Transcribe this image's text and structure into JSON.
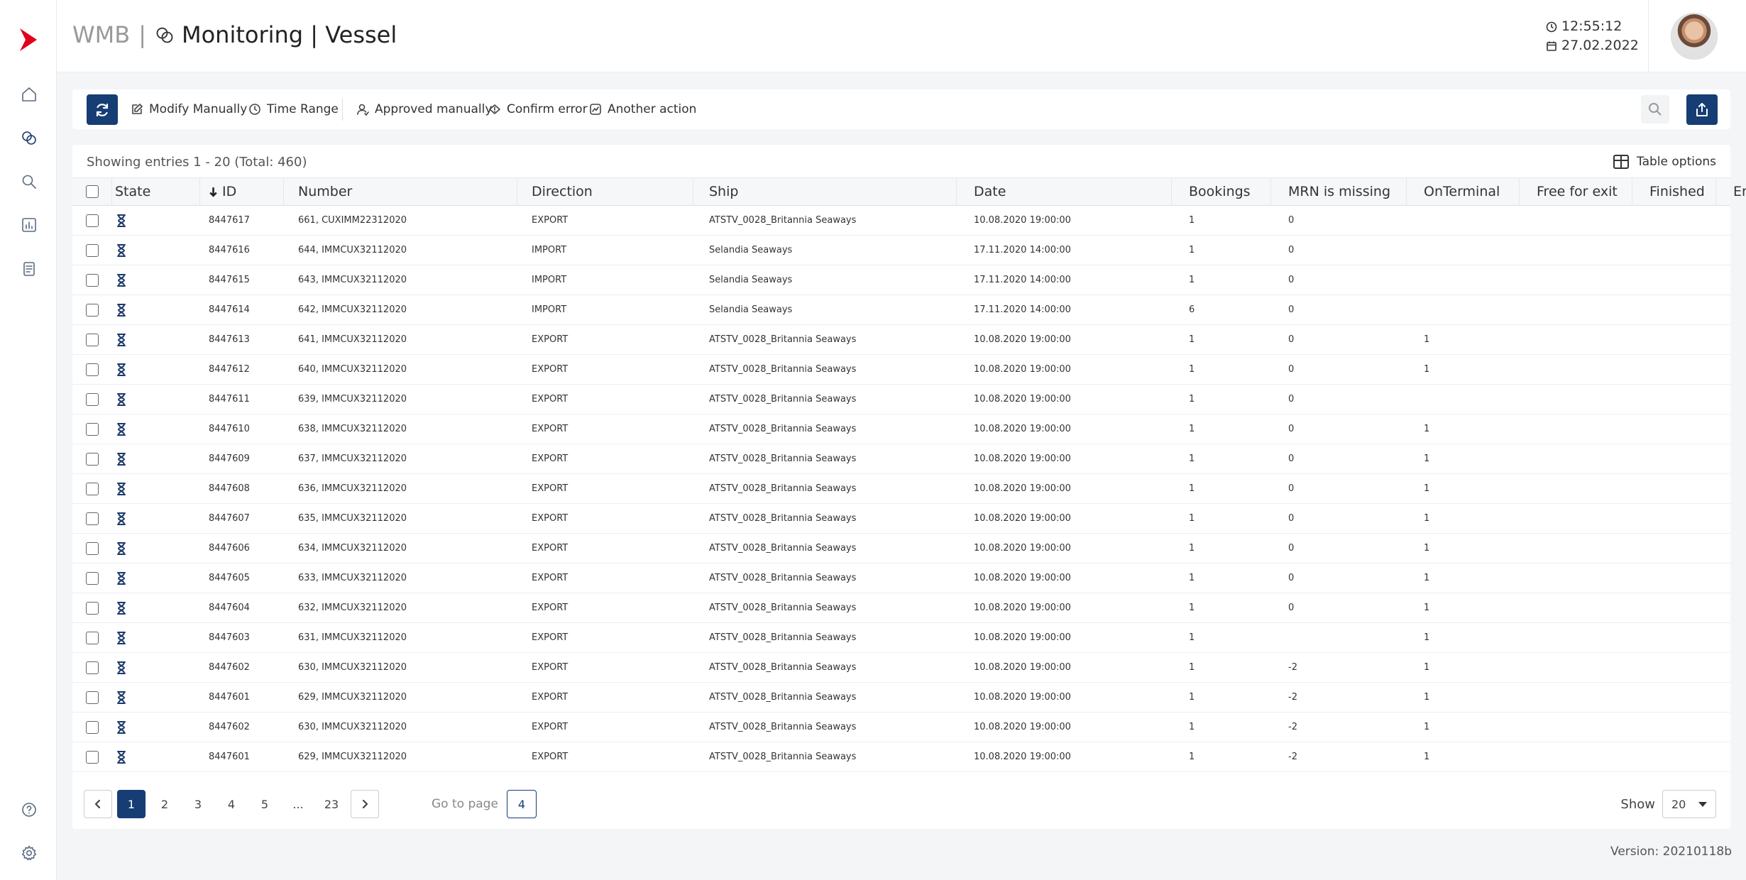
{
  "app": {
    "brand": "WMB",
    "title": "Monitoring | Vessel",
    "time": "12:55:12",
    "date": "27.02.2022",
    "accent_color": "#163d74",
    "logo_color": "#e2001a",
    "version": "Version: 20210118b"
  },
  "sidebar": {
    "items": [
      {
        "icon": "home-icon"
      },
      {
        "icon": "monitoring-icon"
      },
      {
        "icon": "search-icon"
      },
      {
        "icon": "chart-icon"
      },
      {
        "icon": "document-icon"
      }
    ],
    "bottom": [
      {
        "icon": "help-icon"
      },
      {
        "icon": "gear-icon"
      }
    ]
  },
  "toolbar": {
    "modify_manually": "Modify Manually",
    "time_range": "Time Range",
    "approved_manually": "Approved manually",
    "confirm_error": "Confirm error",
    "another_action": "Another action"
  },
  "table": {
    "entries_text": "Showing entries 1 - 20 (Total: 460)",
    "options_label": "Table options",
    "columns": [
      "State",
      "ID",
      "Number",
      "Direction",
      "Ship",
      "Date",
      "Bookings",
      "MRN is missing",
      "OnTerminal",
      "Free for exit",
      "Finished",
      "Error"
    ],
    "rows": [
      {
        "id": "8447617",
        "number": "661, CUXIMM22312020",
        "direction": "EXPORT",
        "ship": "ATSTV_0028_Britannia Seaways",
        "date": "10.08.2020 19:00:00",
        "bookings": "1",
        "mrn": "0",
        "onterminal": "",
        "free": "",
        "finished": "",
        "error": ""
      },
      {
        "id": "8447616",
        "number": "644, IMMCUX32112020",
        "direction": "IMPORT",
        "ship": "Selandia Seaways",
        "date": "17.11.2020 14:00:00",
        "bookings": "1",
        "mrn": "0",
        "onterminal": "",
        "free": "",
        "finished": "",
        "error": ""
      },
      {
        "id": "8447615",
        "number": "643, IMMCUX32112020",
        "direction": "IMPORT",
        "ship": "Selandia Seaways",
        "date": "17.11.2020 14:00:00",
        "bookings": "1",
        "mrn": "0",
        "onterminal": "",
        "free": "",
        "finished": "",
        "error": ""
      },
      {
        "id": "8447614",
        "number": "642, IMMCUX32112020",
        "direction": "IMPORT",
        "ship": "Selandia Seaways",
        "date": "17.11.2020 14:00:00",
        "bookings": "6",
        "mrn": "0",
        "onterminal": "",
        "free": "",
        "finished": "",
        "error": ""
      },
      {
        "id": "8447613",
        "number": "641, IMMCUX32112020",
        "direction": "EXPORT",
        "ship": "ATSTV_0028_Britannia Seaways",
        "date": "10.08.2020 19:00:00",
        "bookings": "1",
        "mrn": "0",
        "onterminal": "1",
        "free": "",
        "finished": "",
        "error": ""
      },
      {
        "id": "8447612",
        "number": "640, IMMCUX32112020",
        "direction": "EXPORT",
        "ship": "ATSTV_0028_Britannia Seaways",
        "date": "10.08.2020 19:00:00",
        "bookings": "1",
        "mrn": "0",
        "onterminal": "1",
        "free": "",
        "finished": "",
        "error": ""
      },
      {
        "id": "8447611",
        "number": "639, IMMCUX32112020",
        "direction": "EXPORT",
        "ship": "ATSTV_0028_Britannia Seaways",
        "date": "10.08.2020 19:00:00",
        "bookings": "1",
        "mrn": "0",
        "onterminal": "",
        "free": "",
        "finished": "",
        "error": ""
      },
      {
        "id": "8447610",
        "number": "638, IMMCUX32112020",
        "direction": "EXPORT",
        "ship": "ATSTV_0028_Britannia Seaways",
        "date": "10.08.2020 19:00:00",
        "bookings": "1",
        "mrn": "0",
        "onterminal": "1",
        "free": "",
        "finished": "",
        "error": ""
      },
      {
        "id": "8447609",
        "number": "637, IMMCUX32112020",
        "direction": "EXPORT",
        "ship": "ATSTV_0028_Britannia Seaways",
        "date": "10.08.2020 19:00:00",
        "bookings": "1",
        "mrn": "0",
        "onterminal": "1",
        "free": "",
        "finished": "",
        "error": ""
      },
      {
        "id": "8447608",
        "number": "636, IMMCUX32112020",
        "direction": "EXPORT",
        "ship": "ATSTV_0028_Britannia Seaways",
        "date": "10.08.2020 19:00:00",
        "bookings": "1",
        "mrn": "0",
        "onterminal": "1",
        "free": "",
        "finished": "",
        "error": ""
      },
      {
        "id": "8447607",
        "number": "635, IMMCUX32112020",
        "direction": "EXPORT",
        "ship": "ATSTV_0028_Britannia Seaways",
        "date": "10.08.2020 19:00:00",
        "bookings": "1",
        "mrn": "0",
        "onterminal": "1",
        "free": "",
        "finished": "",
        "error": ""
      },
      {
        "id": "8447606",
        "number": "634, IMMCUX32112020",
        "direction": "EXPORT",
        "ship": "ATSTV_0028_Britannia Seaways",
        "date": "10.08.2020 19:00:00",
        "bookings": "1",
        "mrn": "0",
        "onterminal": "1",
        "free": "",
        "finished": "",
        "error": ""
      },
      {
        "id": "8447605",
        "number": "633, IMMCUX32112020",
        "direction": "EXPORT",
        "ship": "ATSTV_0028_Britannia Seaways",
        "date": "10.08.2020 19:00:00",
        "bookings": "1",
        "mrn": "0",
        "onterminal": "1",
        "free": "",
        "finished": "",
        "error": ""
      },
      {
        "id": "8447604",
        "number": "632, IMMCUX32112020",
        "direction": "EXPORT",
        "ship": "ATSTV_0028_Britannia Seaways",
        "date": "10.08.2020 19:00:00",
        "bookings": "1",
        "mrn": "0",
        "onterminal": "1",
        "free": "",
        "finished": "",
        "error": ""
      },
      {
        "id": "8447603",
        "number": "631, IMMCUX32112020",
        "direction": "EXPORT",
        "ship": "ATSTV_0028_Britannia Seaways",
        "date": "10.08.2020 19:00:00",
        "bookings": "1",
        "mrn": "",
        "onterminal": "1",
        "free": "",
        "finished": "",
        "error": ""
      },
      {
        "id": "8447602",
        "number": "630, IMMCUX32112020",
        "direction": "EXPORT",
        "ship": "ATSTV_0028_Britannia Seaways",
        "date": "10.08.2020 19:00:00",
        "bookings": "1",
        "mrn": "-2",
        "onterminal": "1",
        "free": "",
        "finished": "",
        "error": ""
      },
      {
        "id": "8447601",
        "number": "629, IMMCUX32112020",
        "direction": "EXPORT",
        "ship": "ATSTV_0028_Britannia Seaways",
        "date": "10.08.2020 19:00:00",
        "bookings": "1",
        "mrn": "-2",
        "onterminal": "1",
        "free": "",
        "finished": "",
        "error": ""
      },
      {
        "id": "8447602",
        "number": "630, IMMCUX32112020",
        "direction": "EXPORT",
        "ship": "ATSTV_0028_Britannia Seaways",
        "date": "10.08.2020 19:00:00",
        "bookings": "1",
        "mrn": "-2",
        "onterminal": "1",
        "free": "",
        "finished": "",
        "error": ""
      },
      {
        "id": "8447601",
        "number": "629, IMMCUX32112020",
        "direction": "EXPORT",
        "ship": "ATSTV_0028_Britannia Seaways",
        "date": "10.08.2020 19:00:00",
        "bookings": "1",
        "mrn": "-2",
        "onterminal": "1",
        "free": "",
        "finished": "",
        "error": ""
      }
    ]
  },
  "pagination": {
    "pages": [
      "1",
      "2",
      "3",
      "4",
      "5",
      "...",
      "23"
    ],
    "current": "1",
    "goto_label": "Go to page",
    "goto_value": "4",
    "show_label": "Show",
    "show_value": "20"
  }
}
